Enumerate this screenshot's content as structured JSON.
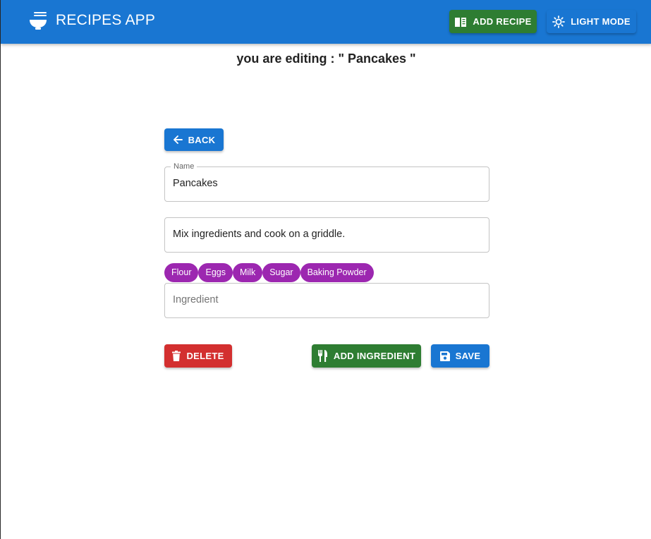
{
  "appbar": {
    "title": "RECIPES APP",
    "brand_icon": "noodle-bowl-icon",
    "add_recipe_label": "ADD RECIPE",
    "add_recipe_icon": "menu-book-icon",
    "theme_label": "LIGHT MODE",
    "theme_icon": "sun-icon",
    "color": "#1976d2"
  },
  "editing": {
    "prefix": "you are editing : \" Pancakes \""
  },
  "back_button": {
    "label": "BACK",
    "icon": "arrow-left-icon"
  },
  "form": {
    "name": {
      "label": "Name",
      "value": "Pancakes"
    },
    "instructions": {
      "value": "Mix ingredients and cook on a griddle."
    },
    "ingredients": [
      "Flour",
      "Eggs",
      "Milk",
      "Sugar",
      "Baking Powder"
    ],
    "ingredient_input": {
      "placeholder": "Ingredient"
    }
  },
  "actions": {
    "delete_label": "DELETE",
    "delete_icon": "trash-icon",
    "add_ingredient_label": "ADD INGREDIENT",
    "add_ingredient_icon": "fork-knife-icon",
    "save_label": "SAVE",
    "save_icon": "floppy-disk-icon"
  },
  "colors": {
    "primary": "#1976d2",
    "success": "#2e7d32",
    "danger": "#d32f2f",
    "chip": "#9c27b0"
  }
}
